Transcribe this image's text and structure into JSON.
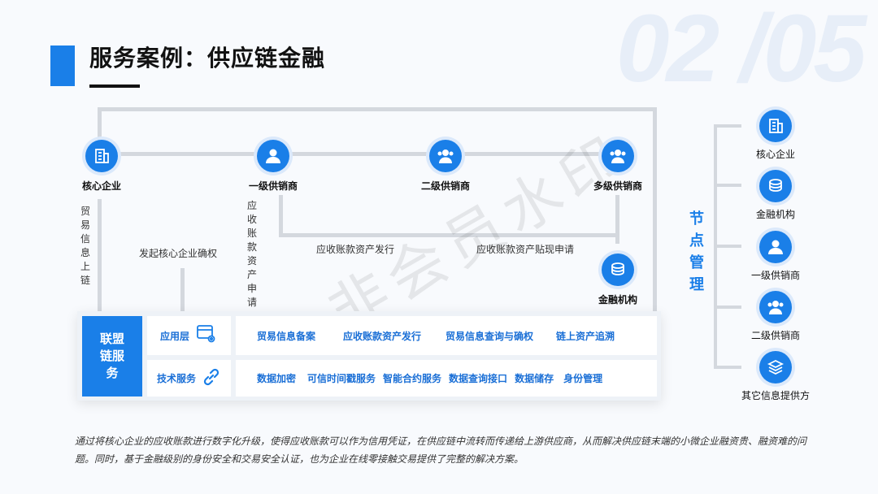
{
  "page_number": "02 /05",
  "title": "服务案例：供应链金融",
  "watermark": "非会员水印",
  "top_nodes": [
    {
      "label": "核心企业",
      "icon": "building-icon"
    },
    {
      "label": "一级供销商",
      "icon": "person-icon"
    },
    {
      "label": "二级供销商",
      "icon": "group-icon"
    },
    {
      "label": "多级供销商",
      "icon": "group-icon"
    }
  ],
  "finance_node": {
    "label": "金融机构",
    "icon": "coins-icon"
  },
  "flow_labels": {
    "trade_uplink": "贸易信息上链",
    "confirm_rights": "发起核心企业确权",
    "receivable_apply": "应收账款资产申请",
    "receivable_issue": "应收账款资产发行",
    "discount_apply": "应收账款资产贴现申请"
  },
  "alliance": {
    "label": "联盟链服务",
    "app_layer": {
      "label": "应用层",
      "items": [
        "贸易信息备案",
        "应收账款资产发行",
        "贸易信息查询与确权",
        "链上资产追溯"
      ]
    },
    "tech_layer": {
      "label": "技术服务",
      "items": [
        "数据加密",
        "可信时间戳服务",
        "智能合约服务",
        "数据查询接口",
        "数据储存",
        "身份管理"
      ]
    }
  },
  "node_management": {
    "title": "节点管理",
    "nodes": [
      {
        "label": "核心企业",
        "icon": "building-icon"
      },
      {
        "label": "金融机构",
        "icon": "coins-icon"
      },
      {
        "label": "一级供销商",
        "icon": "person-icon"
      },
      {
        "label": "二级供销商",
        "icon": "group-icon"
      },
      {
        "label": "其它信息提供方",
        "icon": "stack-icon"
      }
    ]
  },
  "footer": "通过将核心企业的应收账款进行数字化升级，使得应收账款可以作为信用凭证，在供应链中流转而传递给上游供应商，从而解决供应链末端的小微企业融资贵、融资难的问题。同时，基于金融级别的身份安全和交易安全认证，也为企业在线零接触交易提供了完整的解决方案。",
  "colors": {
    "accent": "#1a7fe8",
    "line": "#d4d8de"
  }
}
